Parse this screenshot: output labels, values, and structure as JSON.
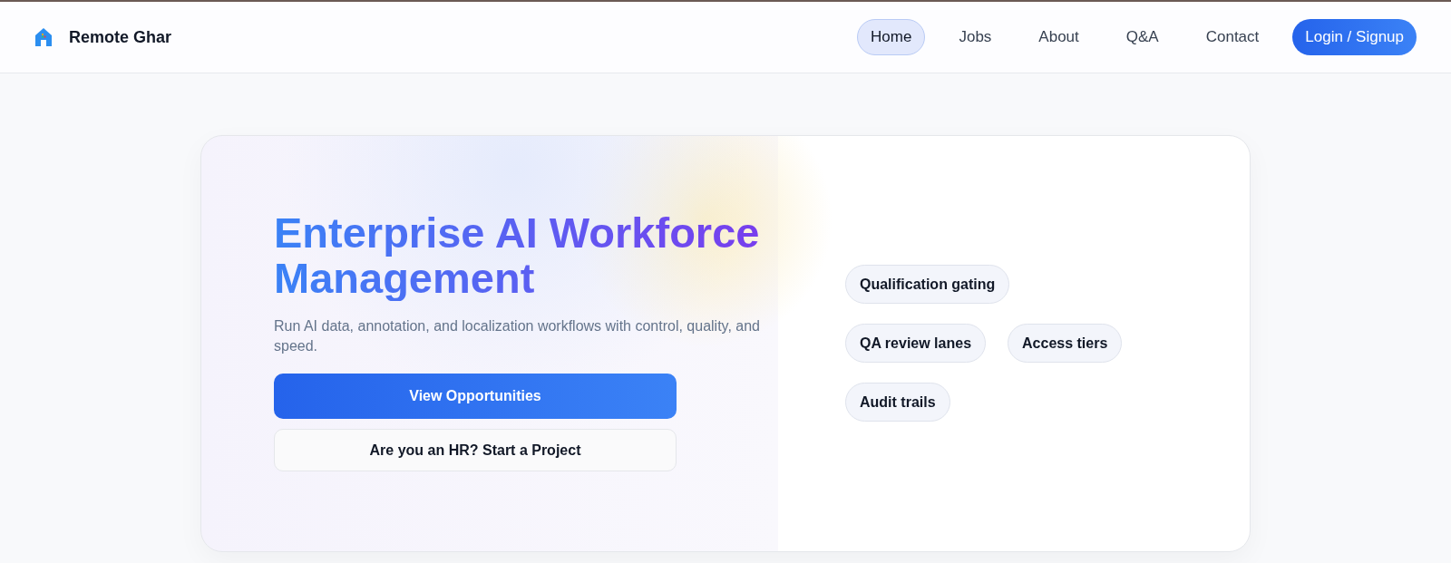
{
  "brand": {
    "name": "Remote Ghar"
  },
  "nav": [
    {
      "label": "Home",
      "selected": true
    },
    {
      "label": "Jobs",
      "selected": false
    },
    {
      "label": "About",
      "selected": false
    },
    {
      "label": "Q&A",
      "selected": false
    },
    {
      "label": "Contact",
      "selected": false
    }
  ],
  "login_button": "Login / Signup",
  "hero": {
    "title": "Enterprise AI Workforce Management",
    "subtitle": "Run AI data, annotation, and localization workflows with control, quality, and speed.",
    "primary_button": "View Opportunities",
    "secondary_button": "Are you an HR? Start a Project"
  },
  "features": [
    [
      "Qualification gating"
    ],
    [
      "QA review lanes",
      "Access tiers"
    ],
    [
      "Audit trails"
    ]
  ]
}
